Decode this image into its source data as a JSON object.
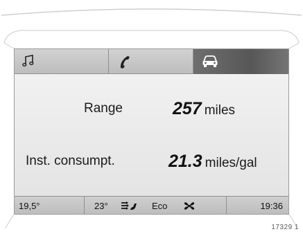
{
  "tabs": [
    {
      "id": "music",
      "icon": "music-note-icon",
      "active": false
    },
    {
      "id": "phone",
      "icon": "phone-handset-icon",
      "active": false
    },
    {
      "id": "vehicle",
      "icon": "car-icon",
      "active": true
    }
  ],
  "trip": {
    "range": {
      "label": "Range",
      "value": "257",
      "unit": "miles"
    },
    "consumption": {
      "label": "Inst. consumpt.",
      "value": "21.3",
      "unit": "miles/gal"
    }
  },
  "status_bar": {
    "outside_temp": "19,5°",
    "set_temp": "23°",
    "air_distribution_icon": "air-distribution-icon",
    "mode": "Eco",
    "fan_icon": "fan-icon",
    "time": "19:36"
  },
  "reference_code": "17329 1",
  "colors": {
    "active_tab": "#5f5f5f",
    "screen_bg": "#ececec",
    "bar_bg": "#c4c4c4"
  }
}
